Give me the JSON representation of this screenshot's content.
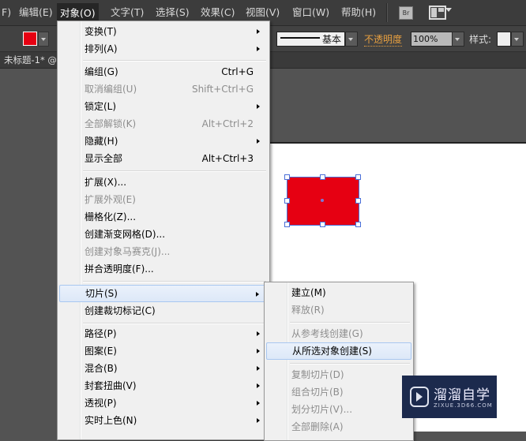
{
  "menubar": {
    "items": [
      {
        "label": "F)"
      },
      {
        "label": "编辑(E)"
      },
      {
        "label": "对象(O)"
      },
      {
        "label": "文字(T)"
      },
      {
        "label": "选择(S)"
      },
      {
        "label": "效果(C)"
      },
      {
        "label": "视图(V)"
      },
      {
        "label": "窗口(W)"
      },
      {
        "label": "帮助(H)"
      }
    ],
    "bridge_label": "Br"
  },
  "control_bar": {
    "fill_color": "#e60012",
    "stroke_profile_label": "基本",
    "opacity_label": "不透明度",
    "opacity_value": "100%",
    "style_label": "样式:"
  },
  "document_tab": {
    "title": "未标题-1* @"
  },
  "object_menu": {
    "items": [
      {
        "label": "变换(T)",
        "shortcut": "",
        "submenu": true,
        "disabled": false
      },
      {
        "label": "排列(A)",
        "shortcut": "",
        "submenu": true,
        "disabled": false
      },
      {
        "label": "编组(G)",
        "shortcut": "Ctrl+G",
        "submenu": false,
        "disabled": false
      },
      {
        "label": "取消编组(U)",
        "shortcut": "Shift+Ctrl+G",
        "submenu": false,
        "disabled": true
      },
      {
        "label": "锁定(L)",
        "shortcut": "",
        "submenu": true,
        "disabled": false
      },
      {
        "label": "全部解锁(K)",
        "shortcut": "Alt+Ctrl+2",
        "submenu": false,
        "disabled": true
      },
      {
        "label": "隐藏(H)",
        "shortcut": "",
        "submenu": true,
        "disabled": false
      },
      {
        "label": "显示全部",
        "shortcut": "Alt+Ctrl+3",
        "submenu": false,
        "disabled": false
      },
      {
        "label": "扩展(X)...",
        "shortcut": "",
        "submenu": false,
        "disabled": false
      },
      {
        "label": "扩展外观(E)",
        "shortcut": "",
        "submenu": false,
        "disabled": true
      },
      {
        "label": "栅格化(Z)...",
        "shortcut": "",
        "submenu": false,
        "disabled": false
      },
      {
        "label": "创建渐变网格(D)...",
        "shortcut": "",
        "submenu": false,
        "disabled": false
      },
      {
        "label": "创建对象马赛克(J)...",
        "shortcut": "",
        "submenu": false,
        "disabled": true
      },
      {
        "label": "拼合透明度(F)...",
        "shortcut": "",
        "submenu": false,
        "disabled": false
      },
      {
        "label": "切片(S)",
        "shortcut": "",
        "submenu": true,
        "disabled": false,
        "highlighted": true
      },
      {
        "label": "创建裁切标记(C)",
        "shortcut": "",
        "submenu": false,
        "disabled": false
      },
      {
        "label": "路径(P)",
        "shortcut": "",
        "submenu": true,
        "disabled": false
      },
      {
        "label": "图案(E)",
        "shortcut": "",
        "submenu": true,
        "disabled": false
      },
      {
        "label": "混合(B)",
        "shortcut": "",
        "submenu": true,
        "disabled": false
      },
      {
        "label": "封套扭曲(V)",
        "shortcut": "",
        "submenu": true,
        "disabled": false
      },
      {
        "label": "透视(P)",
        "shortcut": "",
        "submenu": true,
        "disabled": false
      },
      {
        "label": "实时上色(N)",
        "shortcut": "",
        "submenu": true,
        "disabled": false
      }
    ]
  },
  "slice_submenu": {
    "items": [
      {
        "label": "建立(M)",
        "disabled": false
      },
      {
        "label": "释放(R)",
        "disabled": true
      },
      {
        "label": "从参考线创建(G)",
        "disabled": true
      },
      {
        "label": "从所选对象创建(S)",
        "disabled": false,
        "highlighted": true
      },
      {
        "label": "复制切片(D)",
        "disabled": true
      },
      {
        "label": "组合切片(B)",
        "disabled": true
      },
      {
        "label": "划分切片(V)...",
        "disabled": true
      },
      {
        "label": "全部删除(A)",
        "disabled": true
      }
    ]
  },
  "watermark": {
    "title": "溜溜自学",
    "subtitle": "ZIXUE.3D66.COM"
  }
}
